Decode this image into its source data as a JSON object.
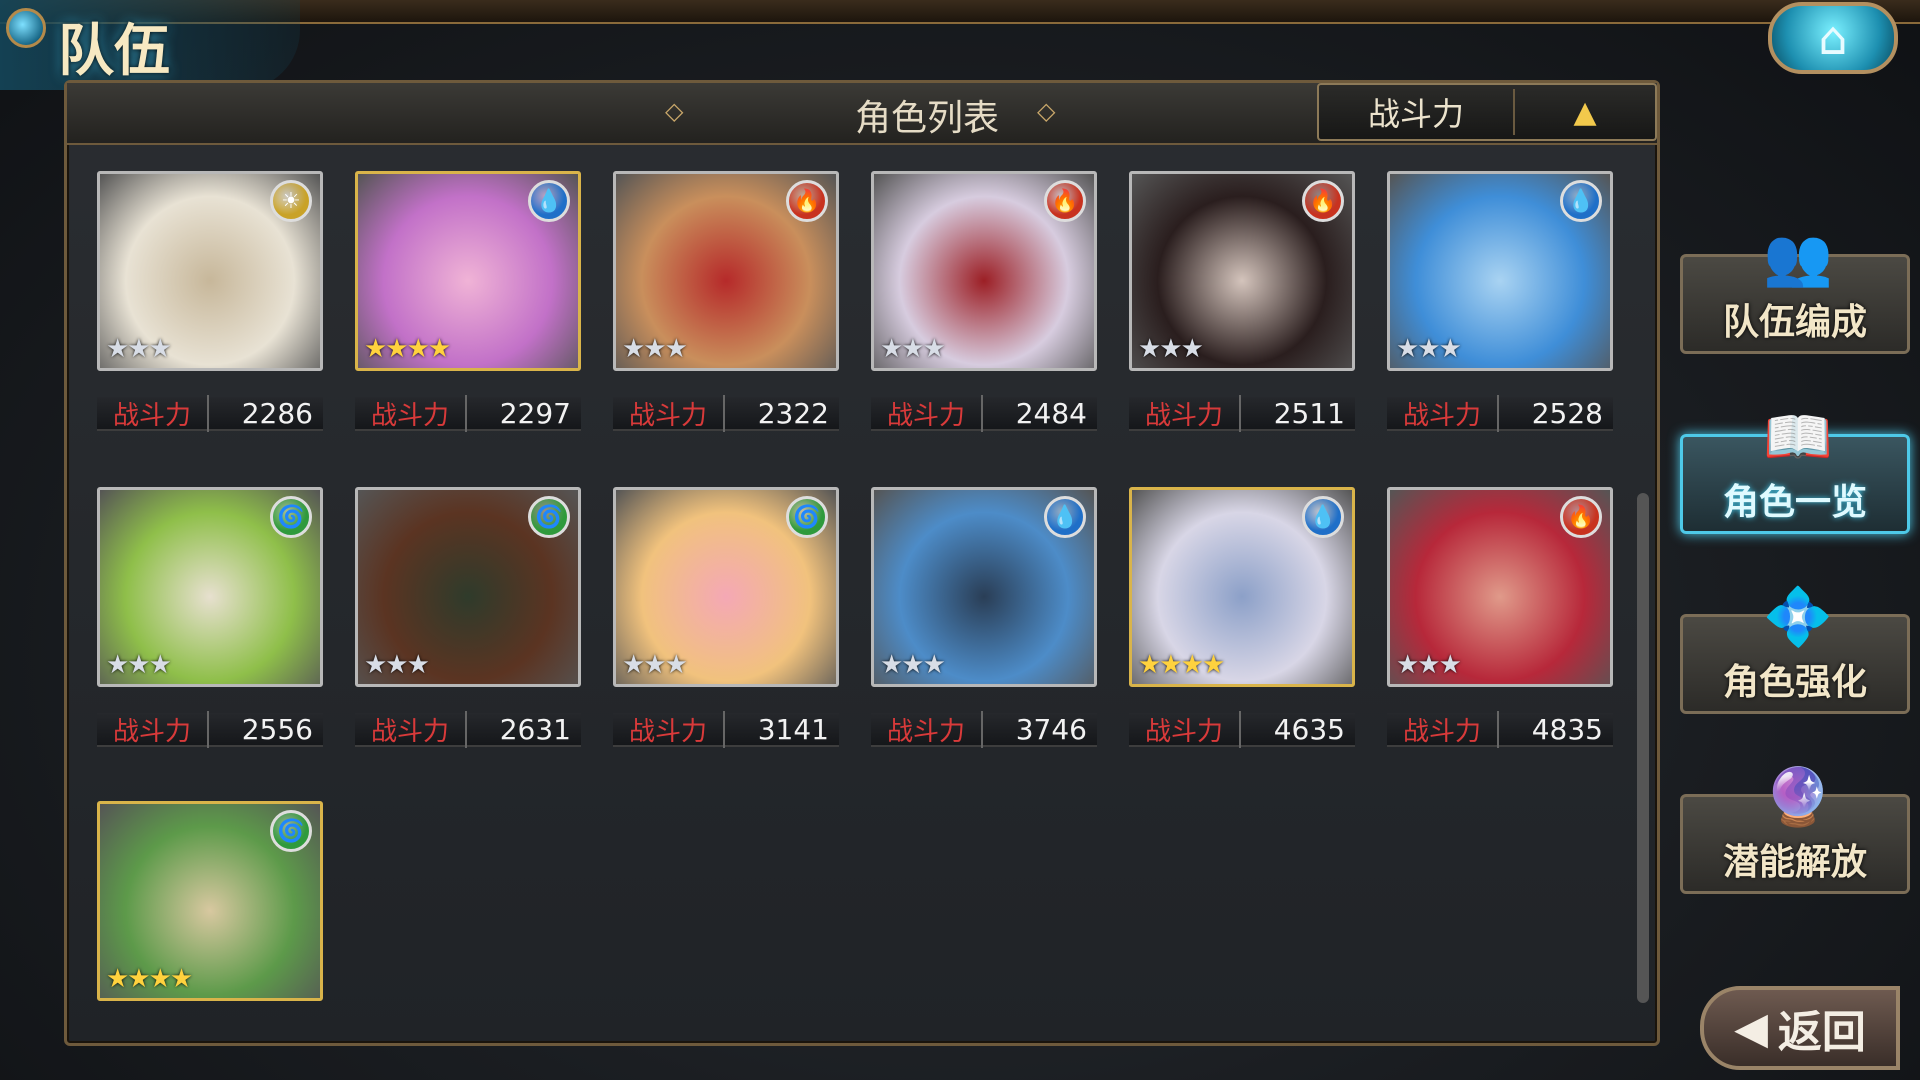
{
  "header": {
    "title": "队伍"
  },
  "panel": {
    "title": "角色列表",
    "sort_label": "战斗力",
    "sort_arrow": "▲"
  },
  "power_label": "战斗力",
  "characters": [
    {
      "power": "2286",
      "element": "sun",
      "element_glyph": "☀",
      "rarity": 3,
      "stars": "★★★",
      "frame": "silver",
      "colors": [
        "#e8e2d4",
        "#c7b79a"
      ],
      "elem_color": "#c9a227"
    },
    {
      "power": "2297",
      "element": "water",
      "element_glyph": "💧",
      "rarity": 4,
      "stars": "★★★★",
      "frame": "gold",
      "colors": [
        "#c271c8",
        "#f0b3d6"
      ],
      "elem_color": "#1f6fc8"
    },
    {
      "power": "2322",
      "element": "fire",
      "element_glyph": "🔥",
      "rarity": 3,
      "stars": "★★★",
      "frame": "silver",
      "colors": [
        "#c98f5c",
        "#b62a2a"
      ],
      "elem_color": "#c8321f"
    },
    {
      "power": "2484",
      "element": "fire",
      "element_glyph": "🔥",
      "rarity": 3,
      "stars": "★★★",
      "frame": "silver",
      "colors": [
        "#d7ccdf",
        "#9c1f25"
      ],
      "elem_color": "#c8321f"
    },
    {
      "power": "2511",
      "element": "fire",
      "element_glyph": "🔥",
      "rarity": 3,
      "stars": "★★★",
      "frame": "silver",
      "colors": [
        "#2a1e1e",
        "#d4c4bc"
      ],
      "elem_color": "#c8321f"
    },
    {
      "power": "2528",
      "element": "water",
      "element_glyph": "💧",
      "rarity": 3,
      "stars": "★★★",
      "frame": "silver",
      "colors": [
        "#3f8ed8",
        "#a9d3f2"
      ],
      "elem_color": "#1f6fc8"
    },
    {
      "power": "2556",
      "element": "wind",
      "element_glyph": "🌀",
      "rarity": 3,
      "stars": "★★★",
      "frame": "silver",
      "colors": [
        "#8fbf4a",
        "#e7e0cf"
      ],
      "elem_color": "#2f9a3c"
    },
    {
      "power": "2631",
      "element": "wind",
      "element_glyph": "🌀",
      "rarity": 3,
      "stars": "★★★",
      "frame": "silver",
      "colors": [
        "#5b3422",
        "#2f3b2b"
      ],
      "elem_color": "#2f9a3c"
    },
    {
      "power": "3141",
      "element": "wind",
      "element_glyph": "🌀",
      "rarity": 3,
      "stars": "★★★",
      "frame": "silver",
      "colors": [
        "#f1c27d",
        "#f4a8b5"
      ],
      "elem_color": "#2f9a3c"
    },
    {
      "power": "3746",
      "element": "water",
      "element_glyph": "💧",
      "rarity": 3,
      "stars": "★★★",
      "frame": "silver",
      "colors": [
        "#4d8cc8",
        "#2a3e56"
      ],
      "elem_color": "#1f6fc8"
    },
    {
      "power": "4635",
      "element": "water",
      "element_glyph": "💧",
      "rarity": 4,
      "stars": "★★★★",
      "frame": "gold",
      "colors": [
        "#d8d6e6",
        "#8ca0c8"
      ],
      "elem_color": "#1f6fc8"
    },
    {
      "power": "4835",
      "element": "fire",
      "element_glyph": "🔥",
      "rarity": 3,
      "stars": "★★★",
      "frame": "silver",
      "colors": [
        "#b7283a",
        "#e09a8a"
      ],
      "elem_color": "#c8321f"
    },
    {
      "power": "",
      "element": "wind",
      "element_glyph": "🌀",
      "rarity": 4,
      "stars": "★★★★",
      "frame": "gold",
      "colors": [
        "#5d9a4a",
        "#d8c8a0"
      ],
      "elem_color": "#2f9a3c"
    }
  ],
  "side_menu": [
    {
      "label": "队伍编成",
      "icon": "team-icon",
      "glyph": "👥",
      "active": false
    },
    {
      "label": "角色一览",
      "icon": "book-icon",
      "glyph": "📖",
      "active": true
    },
    {
      "label": "角色强化",
      "icon": "enhance-icon",
      "glyph": "💠",
      "active": false
    },
    {
      "label": "潜能解放",
      "icon": "potential-icon",
      "glyph": "🔮",
      "active": false
    }
  ],
  "back_button": {
    "label": "返回",
    "arrow": "◀"
  },
  "home_button": {
    "glyph": "⌂"
  }
}
